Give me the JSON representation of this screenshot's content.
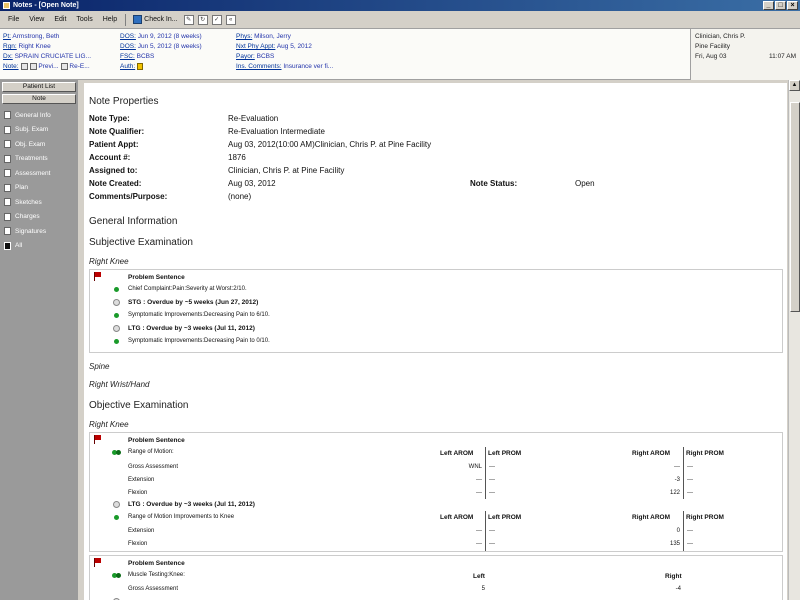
{
  "window": {
    "title": "Notes - [Open Note]",
    "min": "_",
    "max": "□",
    "close": "×"
  },
  "menu": {
    "items": [
      "File",
      "View",
      "Edit",
      "Tools",
      "Help"
    ],
    "check_in": "Check In...",
    "tool_icons": [
      "edit-icon",
      "refresh-icon",
      "check-icon",
      "back-icon"
    ]
  },
  "patient": {
    "pt_label": "Pt:",
    "pt": "Armstrong, Beth",
    "rgn_label": "Rgn:",
    "rgn": "Right Knee",
    "dx_label": "Dx:",
    "dx": "SPRAIN CRUCIATE LIG...",
    "note_label": "Note:",
    "note_prev": "Previ...",
    "note_re": "Re-E...",
    "dos_label": "DOS:",
    "dos": "Jun 9, 2012 (8 weeks)",
    "doi_label": "DOS:",
    "doi": "Jun 5, 2012 (8 weeks)",
    "fsc_label": "FSC:",
    "fsc": "BCBS",
    "auth_label": "Auth:",
    "phys_label": "Phys:",
    "phys": "Milson, Jerry",
    "appt_label": "Nxt Phy Appt:",
    "appt": "Aug 5, 2012",
    "payor_label": "Payor:",
    "payor": "BCBS",
    "ins_label": "Ins. Comments:",
    "ins": "Insurance ver fi...",
    "clinician": "Clinician, Chris P.",
    "facility": "Pine Facility",
    "date": "Fri, Aug 03",
    "time": "11:07 AM"
  },
  "sidebar": {
    "patient_list": "Patient List",
    "note": "Note",
    "items": [
      "General Info",
      "Subj. Exam",
      "Obj. Exam",
      "Treatments",
      "Assessment",
      "Plan",
      "Sketches",
      "Charges",
      "Signatures",
      "All"
    ],
    "selected": "All"
  },
  "note_properties": {
    "heading": "Note Properties",
    "type_lbl": "Note Type:",
    "type": "Re-Evaluation",
    "qual_lbl": "Note Qualifier:",
    "qual": "Re-Evaluation Intermediate",
    "appt_lbl": "Patient Appt:",
    "appt": "Aug 03, 2012(10:00 AM)Clinician, Chris P. at Pine Facility",
    "acct_lbl": "Account #:",
    "acct": "1876",
    "assigned_lbl": "Assigned to:",
    "assigned": "Clinician, Chris P. at Pine Facility",
    "created_lbl": "Note Created:",
    "created": "Aug 03, 2012",
    "status_lbl": "Note Status:",
    "status": "Open",
    "comments_lbl": "Comments/Purpose:",
    "comments": "(none)"
  },
  "sections": {
    "general": "General Information",
    "subjective": "Subjective Examination",
    "objective": "Objective Examination",
    "right_knee": "Right Knee",
    "spine": "Spine",
    "wrist": "Right Wrist/Hand"
  },
  "subj_box": {
    "problem": "Problem Sentence",
    "chief": "Chief Complaint:Pain:Severity at Worst:2/10.",
    "stg": "STG : Overdue by ~5 weeks (Jun 27, 2012)",
    "stg_detail": "Symptomatic Improvements:Decreasing Pain to 6/10.",
    "ltg": "LTG : Overdue by ~3 weeks (Jul 11, 2012)",
    "ltg_detail": "Symptomatic Improvements:Decreasing Pain to 0/10."
  },
  "obj_box": {
    "problem": "Problem Sentence",
    "rom": "Range of Motion:",
    "gross": "Gross Assessment",
    "extension": "Extension",
    "flexion": "Flexion",
    "ltg": "LTG : Overdue by ~3 weeks (Jul 11, 2012)",
    "rom_improve": "Range of Motion Improvements to Knee",
    "cols": [
      "Left AROM",
      "Left PROM",
      "Right AROM",
      "Right PROM"
    ],
    "r1": {
      "la": "WNL",
      "lp": "---",
      "ra": "---",
      "rp": "---"
    },
    "r2": {
      "la": "---",
      "lp": "---",
      "ra": "-3",
      "rp": "---"
    },
    "r3": {
      "la": "---",
      "lp": "---",
      "ra": "122",
      "rp": "---"
    },
    "r4": {
      "la": "---",
      "lp": "---",
      "ra": "0",
      "rp": "---"
    },
    "r5": {
      "la": "---",
      "lp": "---",
      "ra": "135",
      "rp": "---"
    }
  },
  "muscle_box": {
    "problem": "Problem Sentence",
    "muscle": "Muscle Testing:Knee:",
    "left": "Left",
    "right": "Right",
    "gross": "Gross Assessment",
    "gross_left": "5",
    "gross_right": "-4"
  }
}
